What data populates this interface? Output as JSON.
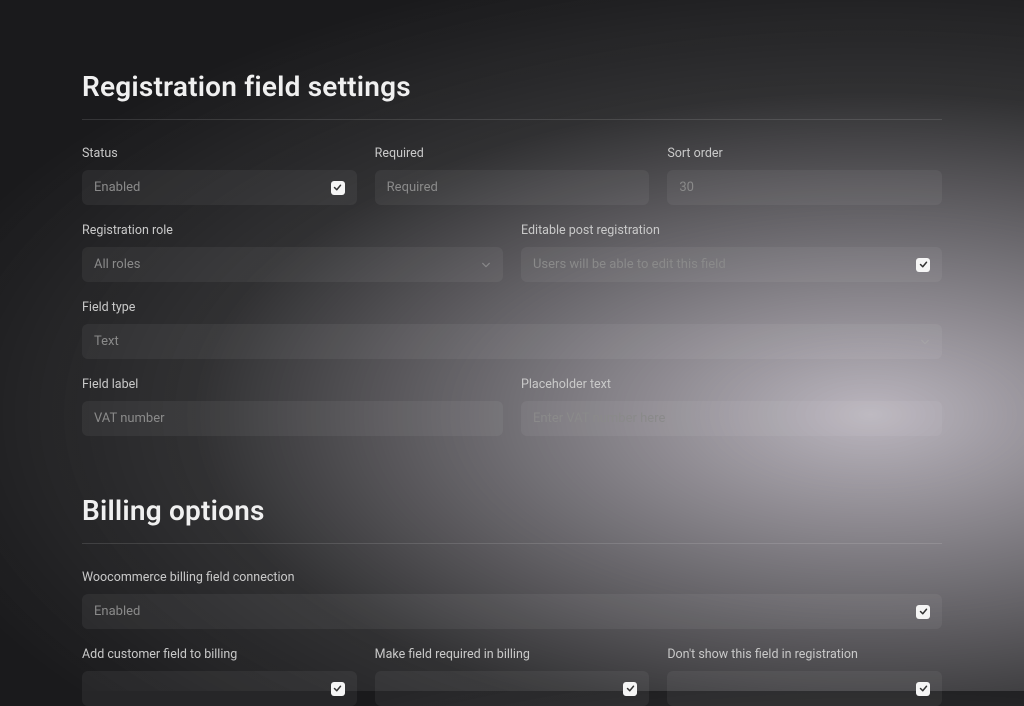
{
  "section1": {
    "title": "Registration field settings",
    "status": {
      "label": "Status",
      "value": "Enabled"
    },
    "required": {
      "label": "Required",
      "value": "Required"
    },
    "sortOrder": {
      "label": "Sort order",
      "value": "30"
    },
    "regRole": {
      "label": "Registration role",
      "value": "All roles"
    },
    "editable": {
      "label": "Editable post registration",
      "value": "Users will be able to edit this field"
    },
    "fieldType": {
      "label": "Field type",
      "value": "Text"
    },
    "fieldLabel": {
      "label": "Field label",
      "value": "VAT number"
    },
    "placeholder": {
      "label": "Placeholder text",
      "value": "Enter VAT number here"
    }
  },
  "section2": {
    "title": "Billing options",
    "connection": {
      "label": "Woocommerce billing field connection",
      "value": "Enabled"
    },
    "addToBilling": {
      "label": "Add customer field to billing"
    },
    "requiredInBilling": {
      "label": "Make field required in billing"
    },
    "dontShow": {
      "label": "Don't show this field in registration"
    }
  }
}
